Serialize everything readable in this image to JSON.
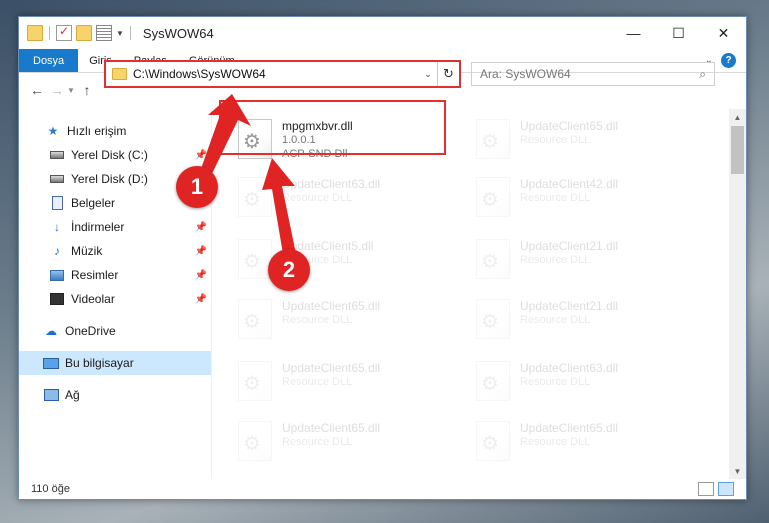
{
  "window": {
    "title": "SysWOW64"
  },
  "ribbon": {
    "tabs": [
      "Dosya",
      "Giriş",
      "Paylaş",
      "Görünüm"
    ],
    "help": "?"
  },
  "address": {
    "path": "C:\\Windows\\SysWOW64"
  },
  "search": {
    "placeholder": "Ara: SysWOW64"
  },
  "sidebar": {
    "items": [
      {
        "label": "Hızlı erişim",
        "icon": "quick-access-star-icon"
      },
      {
        "label": "Yerel Disk (C:)",
        "icon": "drive-icon"
      },
      {
        "label": "Yerel Disk (D:)",
        "icon": "drive-icon"
      },
      {
        "label": "Belgeler",
        "icon": "documents-icon"
      },
      {
        "label": "İndirmeler",
        "icon": "downloads-icon"
      },
      {
        "label": "Müzik",
        "icon": "music-icon"
      },
      {
        "label": "Resimler",
        "icon": "pictures-icon"
      },
      {
        "label": "Videolar",
        "icon": "videos-icon"
      },
      {
        "label": "OneDrive",
        "icon": "onedrive-icon"
      },
      {
        "label": "Bu bilgisayar",
        "icon": "this-pc-icon"
      },
      {
        "label": "Ağ",
        "icon": "network-icon"
      }
    ]
  },
  "files": [
    {
      "name": "mpgmxbvr.dll",
      "line1": "1.0.0.1",
      "line2": "ACP-SND Dll",
      "highlighted": true
    },
    {
      "name": "UpdateClient65.dll",
      "line1": "Resource DLL"
    },
    {
      "name": "UpdateClient63.dll",
      "line1": "Resource DLL"
    },
    {
      "name": "UpdateClient42.dll",
      "line1": "Resource DLL"
    },
    {
      "name": "UpdateClient5.dll",
      "line1": "Resource DLL"
    },
    {
      "name": "UpdateClient21.dll",
      "line1": "Resource DLL"
    },
    {
      "name": "UpdateClient65.dll",
      "line1": "Resource DLL"
    },
    {
      "name": "UpdateClient21.dll",
      "line1": "Resource DLL"
    },
    {
      "name": "UpdateClient65.dll",
      "line1": "Resource DLL"
    },
    {
      "name": "UpdateClient63.dll",
      "line1": "Resource DLL"
    },
    {
      "name": "UpdateClient65.dll",
      "line1": "Resource DLL"
    },
    {
      "name": "UpdateClient65.dll",
      "line1": "Resource DLL"
    }
  ],
  "status": {
    "count": "110 öğe"
  },
  "annotations": {
    "step1": "1",
    "step2": "2",
    "color": "#e02424"
  }
}
